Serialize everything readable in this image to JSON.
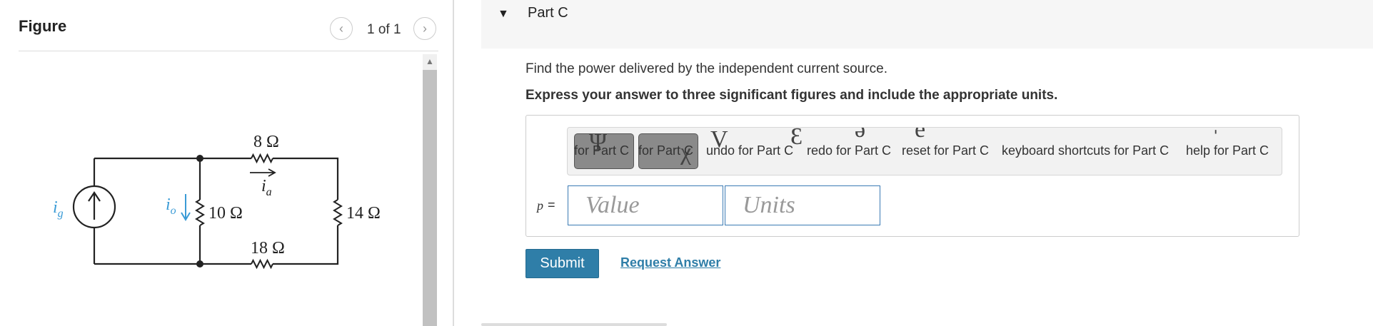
{
  "figure": {
    "title": "Figure",
    "page_counter": "1 of 1",
    "prev_icon": "chevron-left-icon",
    "next_icon": "chevron-right-icon",
    "circuit": {
      "source_label": "i",
      "source_sub": "g",
      "io_label": "i",
      "io_sub": "o",
      "r_top": "8 Ω",
      "ia_label": "i",
      "ia_sub": "a",
      "r_left": "10 Ω",
      "r_right": "14 Ω",
      "r_bottom": "18 Ω",
      "wire_color": "#222222",
      "current_arrow_color": "#3a9bd6"
    }
  },
  "part": {
    "title": "Part C",
    "question": "Find the power delivered by the independent current source.",
    "instruction": "Express your answer to three significant figures and include the appropriate units.",
    "toolbar": {
      "templates_label": "for Part C",
      "symbols_label": "for Part C",
      "undo_label": "undo for Part C",
      "redo_label": "redo for Part C",
      "reset_label": "reset for Part C",
      "keyboard_label": "keyboard shortcuts for Part C",
      "help_label": "help for Part C"
    },
    "answer": {
      "variable": "p",
      "equals": "=",
      "value_placeholder": "Value",
      "units_placeholder": "Units"
    },
    "submit_label": "Submit",
    "request_label": "Request Answer"
  },
  "colors": {
    "accent": "#2f7ea8",
    "input_border": "#3a7ab4",
    "header_bg": "#f6f6f6"
  }
}
